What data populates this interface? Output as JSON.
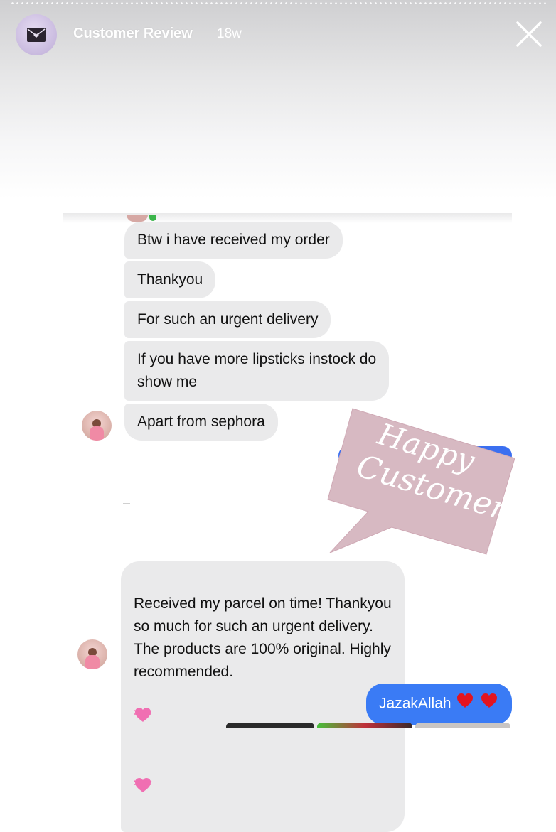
{
  "story": {
    "title": "Customer Review",
    "age": "18w"
  },
  "icons": {
    "avatar": "envelope-heart-icon",
    "close": "close-icon"
  },
  "messages": [
    {
      "text": "Btw i have received my order"
    },
    {
      "text": "Thankyou"
    },
    {
      "text": "For such an urgent delivery"
    },
    {
      "text": "If you have more lipsticks instock do\nshow me"
    },
    {
      "text": "Apart from sephora"
    },
    {
      "text": "Received my parcel on time! Thankyou\nso much for such an urgent delivery.\nThe products are 100% original. Highly\nrecommended."
    }
  ],
  "reply": {
    "text": "JazakAllah"
  },
  "sticker": {
    "line1": "Happy",
    "line2": "Customer"
  },
  "colors": {
    "sent_bubble": "#3a7bf5",
    "received_bubble": "#eaeaeb",
    "sticker": "#d7b9c2"
  }
}
